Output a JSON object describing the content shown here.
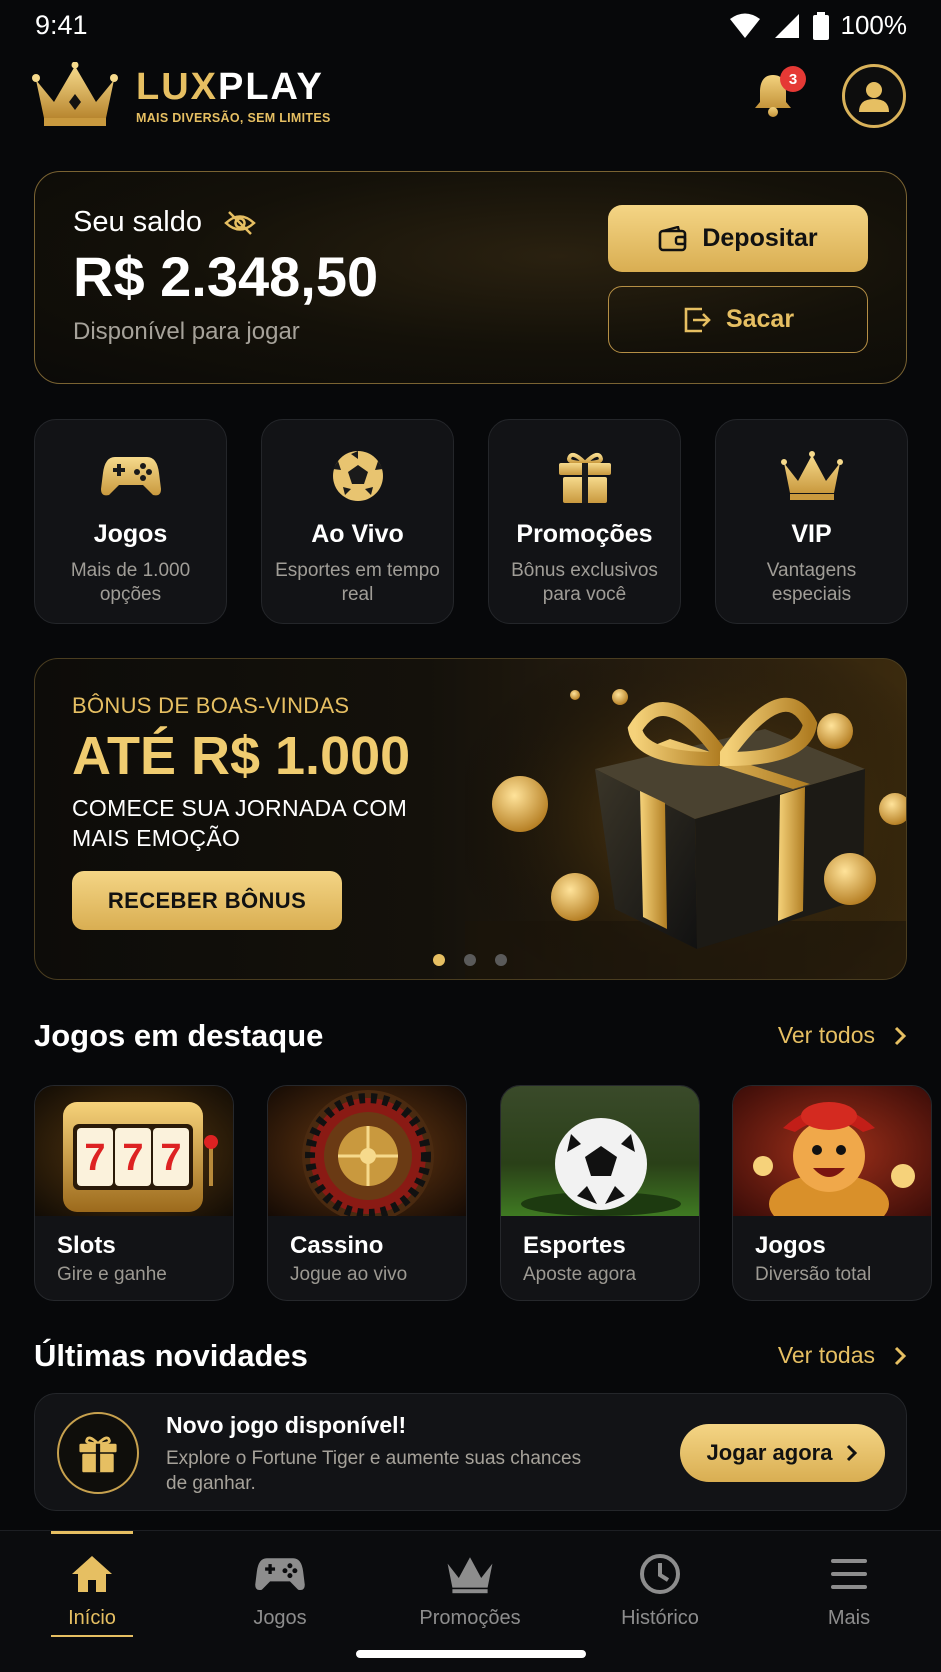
{
  "status_bar": {
    "time": "9:41",
    "battery": "100%"
  },
  "header": {
    "brand_lux": "LUX",
    "brand_play": "PLAY",
    "tagline": "MAIS DIVERSÃO, SEM LIMITES",
    "notification_count": "3"
  },
  "balance": {
    "label": "Seu saldo",
    "amount": "R$ 2.348,50",
    "subtitle": "Disponível para jogar",
    "deposit_label": "Depositar",
    "withdraw_label": "Sacar"
  },
  "quick_actions": [
    {
      "title": "Jogos",
      "desc": "Mais de 1.000 opções",
      "icon": "gamepad-icon"
    },
    {
      "title": "Ao Vivo",
      "desc": "Esportes em tempo real",
      "icon": "soccer-ball-icon"
    },
    {
      "title": "Promoções",
      "desc": "Bônus exclusivos para você",
      "icon": "gift-icon"
    },
    {
      "title": "VIP",
      "desc": "Vantagens especiais",
      "icon": "crown-icon"
    }
  ],
  "promo": {
    "kicker": "BÔNUS DE BOAS-VINDAS",
    "headline": "ATÉ R$ 1.000",
    "description": "COMECE SUA JORNADA COM MAIS EMOÇÃO",
    "cta": "RECEBER BÔNUS",
    "carousel_pages": 3,
    "carousel_active": 1
  },
  "featured": {
    "title": "Jogos em destaque",
    "link": "Ver todos",
    "games": [
      {
        "title": "Slots",
        "subtitle": "Gire e ganhe"
      },
      {
        "title": "Cassino",
        "subtitle": "Jogue ao vivo"
      },
      {
        "title": "Esportes",
        "subtitle": "Aposte agora"
      },
      {
        "title": "Jogos",
        "subtitle": "Diversão total"
      }
    ]
  },
  "news": {
    "title": "Últimas novidades",
    "link": "Ver todas",
    "item_title": "Novo jogo disponível!",
    "item_desc": "Explore o Fortune Tiger e aumente suas chances de ganhar.",
    "item_cta": "Jogar agora"
  },
  "bottom_nav": [
    {
      "label": "Início",
      "icon": "home-icon",
      "active": true
    },
    {
      "label": "Jogos",
      "icon": "gamepad-icon",
      "active": false
    },
    {
      "label": "Promoções",
      "icon": "crown-icon",
      "active": false
    },
    {
      "label": "Histórico",
      "icon": "clock-icon",
      "active": false
    },
    {
      "label": "Mais",
      "icon": "menu-icon",
      "active": false
    }
  ],
  "colors": {
    "accent": "#e6bf62",
    "background": "#07080a",
    "card": "#121316",
    "badge": "#e53935"
  }
}
